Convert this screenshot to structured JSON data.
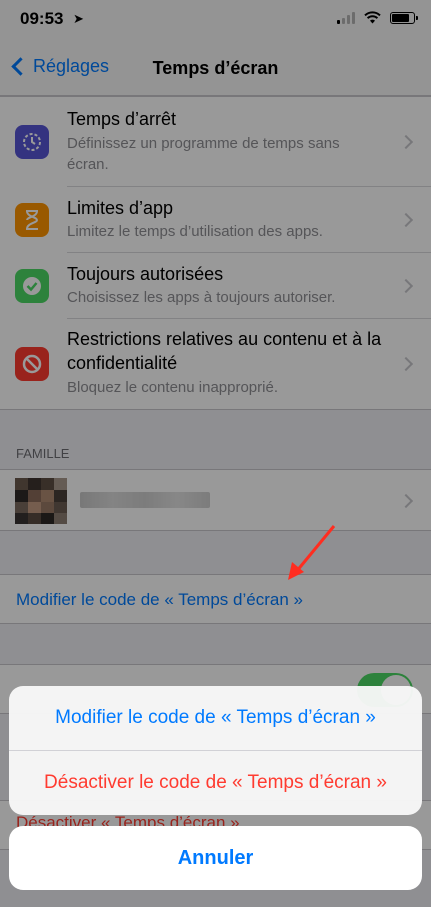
{
  "status_bar": {
    "time": "09:53",
    "location_icon": "location-arrow-icon"
  },
  "nav": {
    "back_label": "Réglages",
    "title": "Temps d’écran"
  },
  "settings": [
    {
      "title": "Temps d’arrêt",
      "subtitle": "Définissez un programme de temps sans écran.",
      "icon": "downtime-icon",
      "color": "#5856d6"
    },
    {
      "title": "Limites d’app",
      "subtitle": "Limitez le temps d’utilisation des apps.",
      "icon": "hourglass-icon",
      "color": "#ff9500"
    },
    {
      "title": "Toujours autorisées",
      "subtitle": "Choisissez les apps à toujours autoriser.",
      "icon": "checkmark-badge-icon",
      "color": "#4cd964"
    },
    {
      "title": "Restrictions relatives au contenu et à la confidentialité",
      "subtitle": "Bloquez le contenu inapproprié.",
      "icon": "no-entry-icon",
      "color": "#ff3b30"
    }
  ],
  "family": {
    "header": "FAMILLE"
  },
  "change_code_link": "Modifier le code de « Temps d’écran »",
  "disable_link": "Désactiver « Temps d’écran »",
  "action_sheet": {
    "change_code": "Modifier le code de « Temps d’écran »",
    "disable_code": "Désactiver le code de « Temps d’écran »",
    "cancel": "Annuler"
  },
  "colors": {
    "accent": "#007aff",
    "destructive": "#ff3b30",
    "toggle_on": "#4cd964",
    "annotation_arrow": "#ff2d20"
  }
}
